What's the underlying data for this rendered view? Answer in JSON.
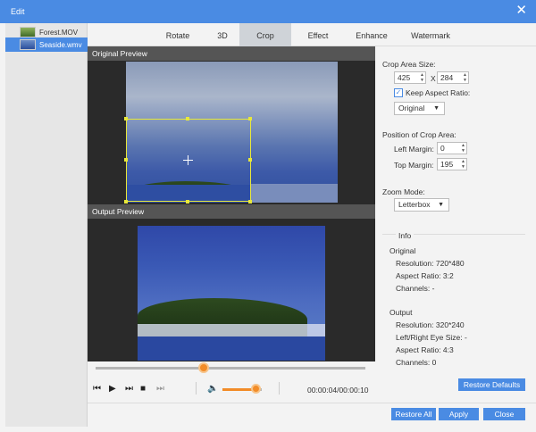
{
  "window": {
    "title": "Edit",
    "close_icon": "close-icon"
  },
  "files": [
    {
      "name": "Forest.MOV",
      "selected": false
    },
    {
      "name": "Seaside.wmv",
      "selected": true
    }
  ],
  "tabs": [
    {
      "label": "Rotate"
    },
    {
      "label": "3D"
    },
    {
      "label": "Crop",
      "active": true
    },
    {
      "label": "Effect"
    },
    {
      "label": "Enhance"
    },
    {
      "label": "Watermark"
    }
  ],
  "preview": {
    "original_title": "Original Preview",
    "output_title": "Output Preview"
  },
  "player": {
    "timecode": "00:00:04/00:00:10",
    "seek_fraction": 0.4,
    "volume_fraction": 0.85
  },
  "crop": {
    "area_size_label": "Crop Area Size:",
    "width": "425",
    "x_label": "X",
    "height": "284",
    "keep_aspect_label": "Keep Aspect Ratio:",
    "keep_aspect_checked": true,
    "aspect_value": "Original",
    "position_label": "Position of Crop Area:",
    "left_margin_label": "Left Margin:",
    "left_margin": "0",
    "top_margin_label": "Top Margin:",
    "top_margin": "195",
    "zoom_label": "Zoom Mode:",
    "zoom_value": "Letterbox"
  },
  "info": {
    "title": "Info",
    "original_title": "Original",
    "original_resolution": "Resolution: 720*480",
    "original_aspect": "Aspect Ratio: 3:2",
    "original_channels": "Channels: -",
    "output_title": "Output",
    "output_resolution": "Resolution: 320*240",
    "output_eye": "Left/Right Eye Size: -",
    "output_aspect": "Aspect Ratio: 4:3",
    "output_channels": "Channels: 0"
  },
  "buttons": {
    "restore_defaults": "Restore Defaults",
    "restore_all": "Restore All",
    "apply": "Apply",
    "close": "Close"
  },
  "colors": {
    "accent": "#4a8be3",
    "crop_frame": "#e8e83a",
    "slider": "#f28c28"
  }
}
